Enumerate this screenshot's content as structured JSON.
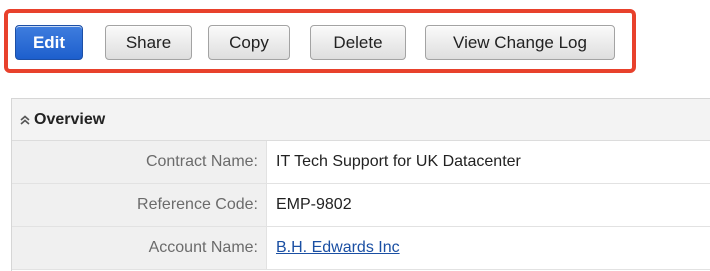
{
  "toolbar": {
    "edit_label": "Edit",
    "share_label": "Share",
    "copy_label": "Copy",
    "delete_label": "Delete",
    "view_change_log_label": "View Change Log",
    "highlight_color": "#e8412c",
    "primary_color": "#2a6ad4"
  },
  "panel": {
    "title": "Overview",
    "fields": [
      {
        "label": "Contract Name:",
        "value": "IT Tech Support for UK Datacenter"
      },
      {
        "label": "Reference Code:",
        "value": "EMP-9802"
      },
      {
        "label": "Account Name:",
        "value": "B.H. Edwards Inc"
      }
    ]
  },
  "icons": {
    "collapse": "double-chevron-up-icon"
  }
}
